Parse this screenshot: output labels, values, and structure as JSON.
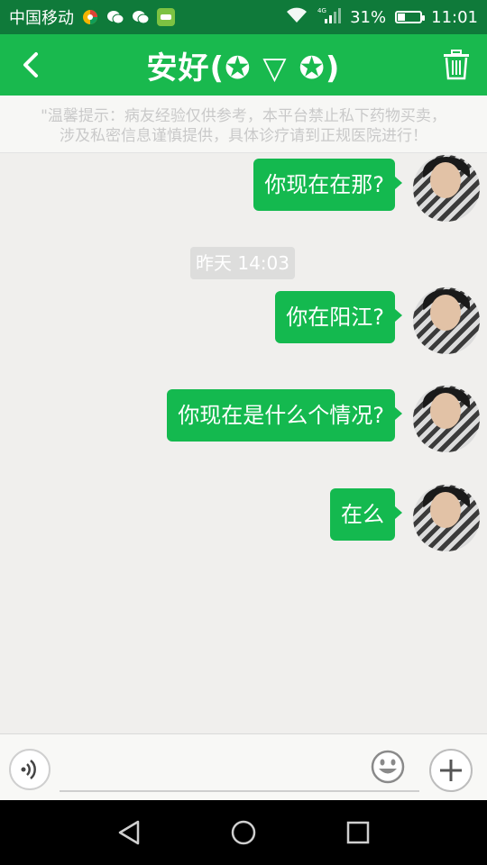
{
  "status_bar": {
    "carrier": "中国移动",
    "network": "4G LTE",
    "battery_text": "31%",
    "battery_level": 0.31,
    "time": "11:01"
  },
  "header": {
    "title": "安好(✪ ▽ ✪)"
  },
  "notice": {
    "line1": "\"温馨提示：病友经验仅供参考，本平台禁止私下药物买卖，",
    "line2": "涉及私密信息谨慎提供，具体诊疗请到正规医院进行！"
  },
  "messages": [
    {
      "text": "你现在在那?"
    },
    {
      "text": "你在阳江?"
    },
    {
      "text": "你现在是什么个情况?"
    },
    {
      "text": "在么"
    }
  ],
  "timestamp": "昨天 14:03",
  "input": {
    "placeholder": ""
  },
  "colors": {
    "brand_green": "#19b94e",
    "bubble_green": "#14b94f",
    "status_bar": "#0f7a3a"
  },
  "icons": {
    "back": "chevron-left-icon",
    "trash": "trash-icon",
    "voice": "voice-icon",
    "emoji": "smiley-icon",
    "plus": "plus-icon",
    "nav_back": "triangle-back-icon",
    "nav_home": "circle-home-icon",
    "nav_recent": "square-recent-icon"
  }
}
